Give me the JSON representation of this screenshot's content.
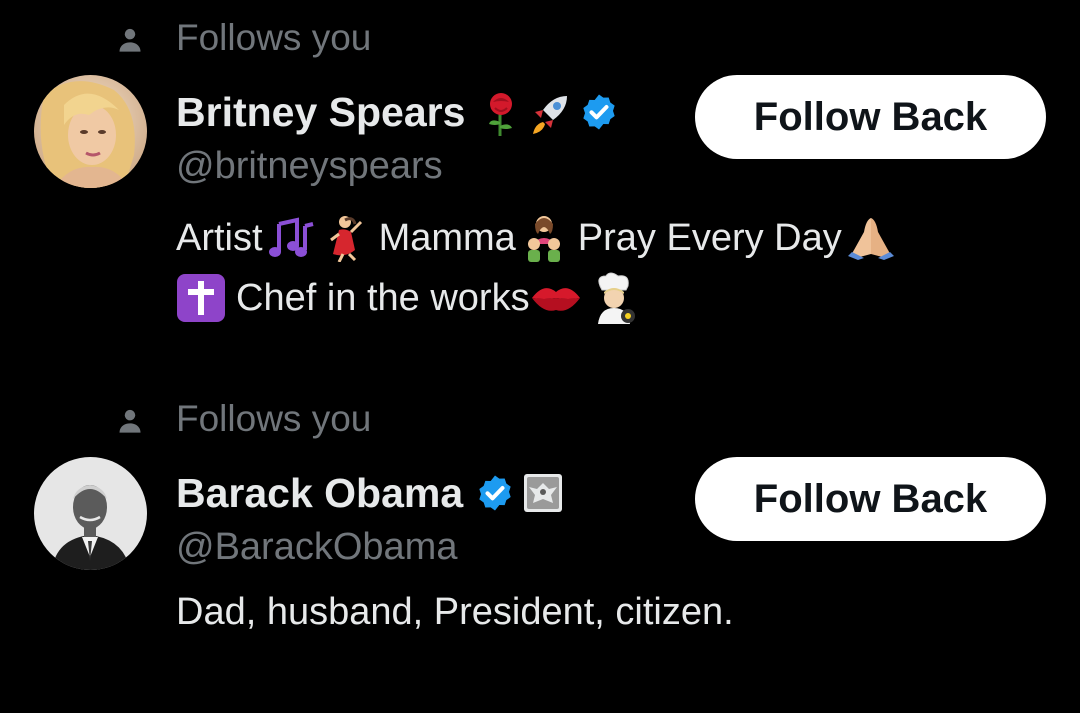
{
  "followers": [
    {
      "follows_label": "Follows you",
      "display_name": "Britney Spears",
      "name_badges": [
        "rose-emoji",
        "rocket-emoji",
        "verified-badge"
      ],
      "handle": "@britneyspears",
      "bio_lines": [
        {
          "segments": [
            {
              "text": "Artist"
            },
            {
              "icon": "musical-notes-emoji"
            },
            {
              "icon": "dancer-emoji"
            },
            {
              "text": "Mamma"
            },
            {
              "icon": "family-emoji"
            },
            {
              "text": "Pray Every Day"
            },
            {
              "icon": "praying-hands-emoji"
            }
          ]
        },
        {
          "segments": [
            {
              "icon": "latin-cross-emoji"
            },
            {
              "text": "Chef in the works"
            },
            {
              "icon": "kiss-mark-emoji"
            },
            {
              "icon": "cook-emoji"
            }
          ]
        }
      ],
      "button_label": "Follow Back"
    },
    {
      "follows_label": "Follows you",
      "display_name": "Barack Obama",
      "name_badges": [
        "verified-badge",
        "government-seal-badge"
      ],
      "handle": "@BarackObama",
      "bio_lines": [
        {
          "segments": [
            {
              "text": "Dad, husband, President, citizen."
            }
          ]
        }
      ],
      "button_label": "Follow Back"
    }
  ],
  "colors": {
    "background": "#000000",
    "primary_text": "#e7e9ea",
    "secondary_text": "#71767b",
    "button_bg": "#ffffff",
    "button_text": "#0f1419",
    "verified": "#1d9bf0"
  }
}
